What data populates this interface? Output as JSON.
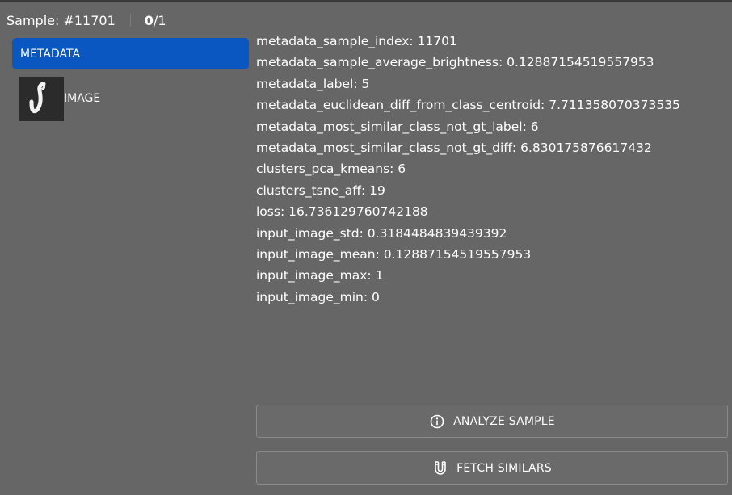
{
  "header": {
    "sample": "Sample: #11701",
    "count_current": "0",
    "count_total": "/1"
  },
  "sidebar": {
    "items": [
      {
        "label": "METADATA",
        "active": true
      },
      {
        "label": "IMAGE",
        "active": false
      }
    ]
  },
  "metadata": [
    "metadata_sample_index: 11701",
    "metadata_sample_average_brightness: 0.12887154519557953",
    "metadata_label: 5",
    "metadata_euclidean_diff_from_class_centroid: 7.711358070373535",
    "metadata_most_similar_class_not_gt_label: 6",
    "metadata_most_similar_class_not_gt_diff: 6.830175876617432",
    "clusters_pca_kmeans: 6",
    "clusters_tsne_aff: 19",
    "loss: 16.736129760742188",
    "input_image_std: 0.3184484839439392",
    "input_image_mean: 0.12887154519557953",
    "input_image_max: 1",
    "input_image_min: 0"
  ],
  "buttons": {
    "analyze": {
      "label": "ANALYZE SAMPLE",
      "icon": "info-icon"
    },
    "fetch": {
      "label": "FETCH SIMILARS",
      "icon": "magnet-icon"
    }
  },
  "colors": {
    "background": "#666666",
    "active_tab": "#0a57c2",
    "text": "#ffffff"
  }
}
